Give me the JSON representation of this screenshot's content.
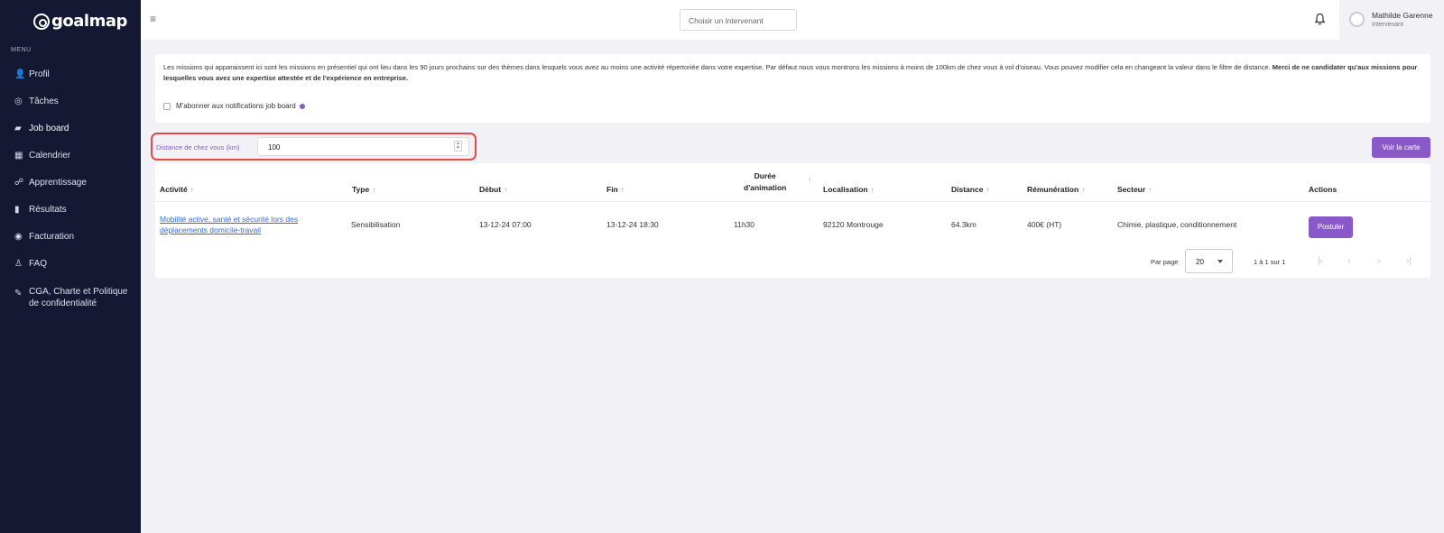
{
  "brand": {
    "name": "goalmap"
  },
  "sidebar": {
    "menu_label": "MENU",
    "items": [
      {
        "label": "Profil",
        "icon": "person-icon",
        "glyph": "👤"
      },
      {
        "label": "Tâches",
        "icon": "check-circle-icon",
        "glyph": "◎"
      },
      {
        "label": "Job board",
        "icon": "job-board-icon",
        "glyph": "▰"
      },
      {
        "label": "Calendrier",
        "icon": "calendar-icon",
        "glyph": "▦"
      },
      {
        "label": "Apprentissage",
        "icon": "learning-icon",
        "glyph": "☍"
      },
      {
        "label": "Résultats",
        "icon": "bar-chart-icon",
        "glyph": "▮"
      },
      {
        "label": "Facturation",
        "icon": "piggy-bank-icon",
        "glyph": "◉"
      },
      {
        "label": "FAQ",
        "icon": "lamp-icon",
        "glyph": "♙"
      },
      {
        "label": "CGA, Charte et Politique de confidentialité",
        "icon": "document-edit-icon",
        "glyph": "✎"
      }
    ]
  },
  "topbar": {
    "intervenant_placeholder": "Choisir un intervenant",
    "user_name": "Mathilde Garenne",
    "user_role": "Intervenant"
  },
  "info": {
    "text": "Les missions qui apparaissent ici sont les missions en présentiel qui ont lieu dans les 90 jours prochains sur des thèmes dans lesquels vous avez au moins une activité répertoriée dans votre expertise. Par défaut nous vous montrons les missions à moins de 100km de chez vous à vol d'oiseau. Vous pouvez modifier cela en changeant la valeur dans le filtre de distance. ",
    "text_bold": "Merci de ne candidater qu'aux missions pour lesquelles vous avez une expertise attestée et de l'expérience en entreprise.",
    "subscribe_label": "M'abonner aux notifications job board"
  },
  "filter": {
    "distance_label": "Distance de chez vous (km)",
    "distance_value": "100",
    "map_button": "Voir la carte"
  },
  "table": {
    "headers": {
      "activite": "Activité",
      "type": "Type",
      "debut": "Début",
      "fin": "Fin",
      "duree_line1": "Durée",
      "duree_line2": "d'animation",
      "localisation": "Localisation",
      "distance": "Distance",
      "remuneration": "Rémunération",
      "secteur": "Secteur",
      "actions": "Actions"
    },
    "rows": [
      {
        "activite": "Mobilité active, santé et sécurité lors des déplacements domicile-travail",
        "type": "Sensibilisation",
        "debut": "13-12-24 07:00",
        "fin": "13-12-24 18:30",
        "duree": "11h30",
        "localisation": "92120 Montrouge",
        "distance": "64.3km",
        "remuneration": "400€ (HT)",
        "secteur": "Chimie, plastique, conditionnement",
        "action_label": "Postuler"
      }
    ],
    "pagination": {
      "per_page_label": "Par page",
      "per_page_value": "20",
      "range": "1 à 1 sur 1"
    }
  }
}
